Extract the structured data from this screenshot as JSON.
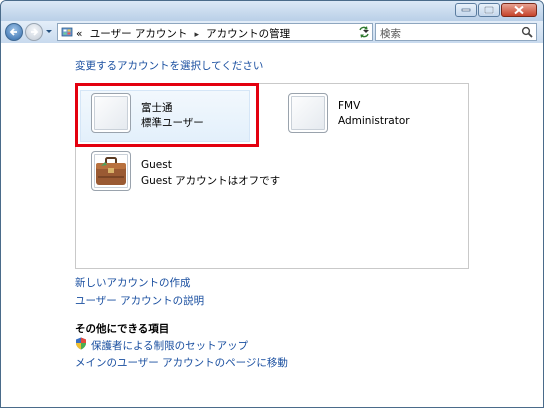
{
  "window": {
    "controls": [
      "minimize",
      "maximize",
      "close"
    ]
  },
  "nav": {
    "breadcrumb_prefix": "«",
    "breadcrumbs": [
      "ユーザー アカウント",
      "アカウントの管理"
    ],
    "search_placeholder": "検索",
    "icons": [
      "back-arrow-icon",
      "forward-arrow-icon",
      "control-panel-icon",
      "refresh-icon",
      "search-icon"
    ]
  },
  "main": {
    "prompt": "変更するアカウントを選択してください",
    "accounts": [
      {
        "name": "富士通",
        "type": "標準ユーザー",
        "selected": true
      },
      {
        "name": "FMV",
        "type": "Administrator",
        "selected": false
      },
      {
        "name": "Guest",
        "type": "Guest アカウントはオフです",
        "selected": false
      }
    ],
    "links": {
      "create": "新しいアカウントの作成",
      "about": "ユーザー アカウントの説明"
    },
    "other_heading": "その他にできる項目",
    "other_links": {
      "parental": "保護者による制限のセットアップ",
      "main_page": "メインのユーザー アカウントのページに移動"
    }
  },
  "colors": {
    "link": "#1a4fa0",
    "highlight": "#e3000f"
  }
}
